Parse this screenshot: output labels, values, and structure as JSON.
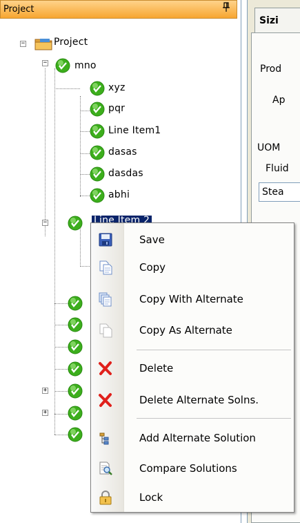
{
  "panel": {
    "title": "Project",
    "pin_glyph": "║"
  },
  "tree": {
    "root": {
      "label": "Project",
      "icon": "folder-icon",
      "expander": "−"
    },
    "groups": [
      {
        "label": "mno",
        "expander": "−",
        "icon": "check-circle-icon",
        "children": [
          "xyz",
          "pqr",
          "Line Item1",
          "dasas",
          "dasdas",
          "abhi"
        ]
      },
      {
        "label": "Line Item 2",
        "expander": "−",
        "icon": "check-circle-icon",
        "selected": true
      }
    ],
    "collapsed_expander": "+"
  },
  "dialog": {
    "tab_label": "Sizi",
    "labels": [
      "Prod",
      "Ap",
      "UOM",
      "Fluid"
    ],
    "field_value": "Stea"
  },
  "context_menu": {
    "items": [
      {
        "label": "Save",
        "icon": "save-icon"
      },
      {
        "label": "Copy",
        "icon": "copy-icon"
      },
      {
        "label": "Copy With Alternate",
        "icon": "copy-with-alternate-icon"
      },
      {
        "label": "Copy As Alternate",
        "icon": "copy-as-alternate-icon"
      },
      {
        "label": "Delete",
        "icon": "delete-icon"
      },
      {
        "label": "Delete Alternate Solns.",
        "icon": "delete-alternate-icon"
      },
      {
        "label": "Add Alternate Solution",
        "icon": "add-alternate-solution-icon"
      },
      {
        "label": "Compare Solutions",
        "icon": "compare-solutions-icon"
      },
      {
        "label": "Lock",
        "icon": "lock-icon"
      }
    ]
  },
  "colors": {
    "header": "#f7a631",
    "selection": "#0a246a",
    "check_green": "#3cae1c",
    "delete_red": "#e0201b"
  }
}
